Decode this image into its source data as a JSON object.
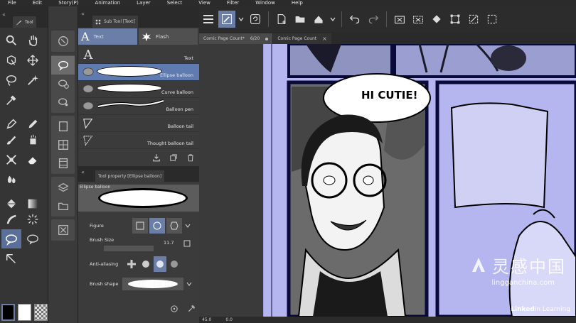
{
  "menu": [
    "File",
    "Edit",
    "Story(P)",
    "Animation",
    "Layer",
    "Select",
    "View",
    "Filter",
    "Window",
    "Help"
  ],
  "tool_panel": {
    "tab_label": "Tool"
  },
  "sub_tool": {
    "tab_label": "Sub Tool [Text]",
    "groups": [
      {
        "label": "Text",
        "selected": true
      },
      {
        "label": "Flash",
        "selected": false
      }
    ],
    "items": [
      {
        "label": "Text",
        "selected": false
      },
      {
        "label": "Ellipse balloon",
        "selected": true
      },
      {
        "label": "Curve balloon",
        "selected": false
      },
      {
        "label": "Balloon pen",
        "selected": false
      },
      {
        "label": "Balloon tail",
        "selected": false
      },
      {
        "label": "Thought balloon tail",
        "selected": false
      }
    ]
  },
  "tool_property": {
    "tab_label": "Tool property [Ellipse balloon]",
    "preview_caption": "Ellipse balloon",
    "figure_label": "Figure",
    "brush_size_label": "Brush Size",
    "brush_size_value": "11.7",
    "anti_aliasing_label": "Anti-aliasing",
    "brush_shape_label": "Brush shape"
  },
  "doc_tabs": [
    {
      "label": "Comic Page Count*",
      "page": "6/20",
      "selected": true
    },
    {
      "label": "Comic Page Count",
      "page": "",
      "selected": false
    }
  ],
  "canvas": {
    "balloon_text": "HI CUTIE!"
  },
  "status": {
    "zoom": "45.0",
    "angle": "0.0"
  },
  "watermark": {
    "cn": "灵感中国",
    "url": "lingganchina.com",
    "linkedin": "Linked",
    "learning": "in Learning"
  },
  "colors": {
    "accent": "#6a7ea8",
    "page": "#b5b5ef",
    "panel": "#3b3b3b"
  }
}
